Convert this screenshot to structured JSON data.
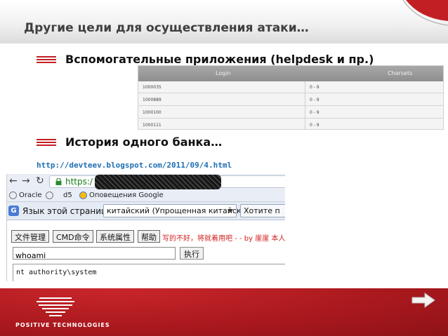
{
  "slide": {
    "title": "Другие цели для осуществления атаки…",
    "bullets": [
      "Вспомогательные приложения (helpdesk и пр.)",
      "История одного банка…"
    ],
    "link": "http://devteev.blogspot.com/2011/09/4.html",
    "accent_color": "#c21f24"
  },
  "table": {
    "headers": [
      "Login",
      "Charsets"
    ],
    "rows": [
      [
        "1000035",
        "0 - 9"
      ],
      [
        "1000889",
        "0 - 9"
      ],
      [
        "1000100",
        "0 - 9"
      ],
      [
        "1000111",
        "0 - 9"
      ]
    ]
  },
  "browser": {
    "url_visible": "https:/",
    "bookmarks": [
      "Oracle",
      "d5",
      "Оповещения Google"
    ],
    "translate": {
      "prompt": "Язык этой страницы",
      "selected_language": "китайский (Упрощенная китайская)",
      "action": "Хотите п"
    },
    "menu": [
      "文件管理",
      "CMD命令",
      "系统属性",
      "帮助"
    ],
    "menu_note": "写的不好，将就着用吧 - - by 崖崖 本人收集",
    "command_value": "whoami",
    "exec_label": "执行",
    "output": "nt authority\\system"
  },
  "footer": {
    "brand": "POSITIVE TECHNOLOGIES",
    "background_color": "#a8181d"
  },
  "icons": [
    "bullet-icon",
    "back-arrow-icon",
    "forward-arrow-icon",
    "reload-icon",
    "lock-icon",
    "google-translate-icon",
    "next-slide-arrow-icon",
    "pt-logo-icon"
  ]
}
